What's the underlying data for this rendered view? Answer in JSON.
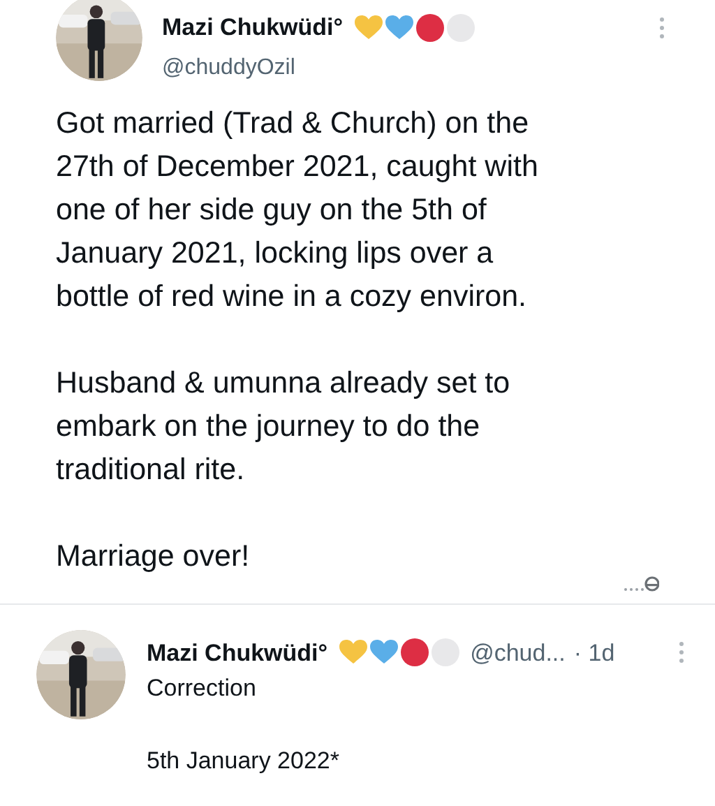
{
  "tweet": {
    "author": {
      "name": "Mazi Chukwüdi°",
      "handle": "@chuddyOzil"
    },
    "paragraphs": [
      "Got married (Trad & Church) on the\n27th of December 2021, caught with\none of her side guy on the 5th of\nJanuary 2021, locking lips over a\nbottle of red wine in a cozy environ.",
      "Husband & umunna already set to\nembark on the journey to do the\ntraditional rite.",
      "Marriage over!"
    ]
  },
  "reply": {
    "author": {
      "name": "Mazi Chukwüdi°",
      "handle": "@chud...",
      "time": "· 1d"
    },
    "paragraphs": [
      "Correction",
      "5th January 2022*"
    ]
  }
}
